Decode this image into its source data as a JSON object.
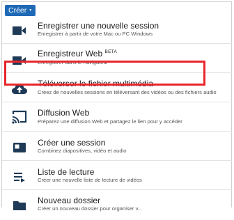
{
  "toolbar": {
    "create_label": "Créer",
    "create_caret": "▾"
  },
  "menu": {
    "items": [
      {
        "id": "record",
        "icon": "video-camera-icon",
        "title": "Enregistrer une nouvelle session",
        "subtitle": "Enregistrer à partir de votre Mac ou PC Windows"
      },
      {
        "id": "web-recorder",
        "icon": "video-camera-icon",
        "title": "Enregistreur Web",
        "badge": "BETA",
        "subtitle": "Enregistrer dans le navigateur",
        "highlighted": true
      },
      {
        "id": "upload",
        "icon": "cloud-upload-icon",
        "title": "Téléverser le fichier multimédia",
        "subtitle": "Créez de nouvelles sessions en téléversant des vidéos ou des fichiers audio"
      },
      {
        "id": "webcast",
        "icon": "cast-icon",
        "title": "Diffusion Web",
        "subtitle": "Préparez une diffusion Web et partagez le lien pour y accéder"
      },
      {
        "id": "create-session",
        "icon": "slides-icon",
        "title": "Créer une session",
        "subtitle": "Combinez diapositives, vidéo et audio"
      },
      {
        "id": "playlist",
        "icon": "playlist-icon",
        "title": "Liste de lecture",
        "subtitle": "Créer une nouvelle liste de lecture de vidéos"
      },
      {
        "id": "folder",
        "icon": "folder-icon",
        "title": "Nouveau dossier",
        "subtitle": "Créer un nouveau dossier pour organiser v..."
      }
    ]
  },
  "colors": {
    "accent": "#1f6ab7",
    "highlight_border": "#e8262b",
    "icon": "#1e3a56"
  }
}
